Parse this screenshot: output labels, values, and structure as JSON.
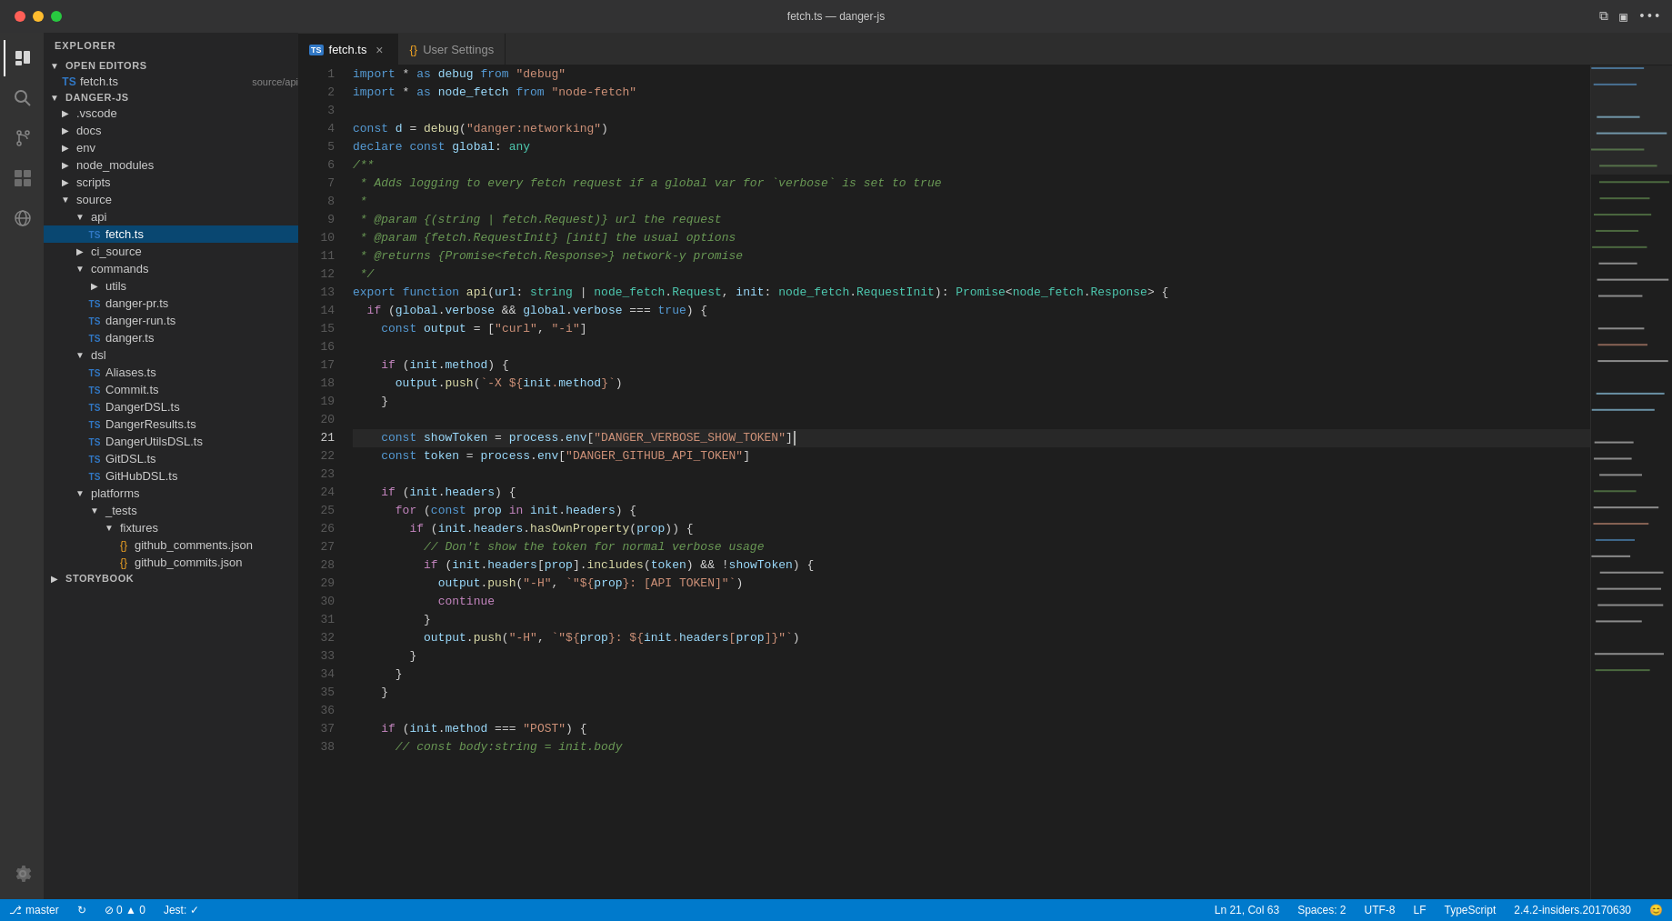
{
  "titlebar": {
    "title": "fetch.ts — danger-js",
    "actions": [
      "split-editor-icon",
      "toggle-panel-icon",
      "more-icon"
    ]
  },
  "activity_bar": {
    "icons": [
      {
        "name": "explorer-icon",
        "symbol": "☰",
        "active": true
      },
      {
        "name": "search-icon",
        "symbol": "🔍",
        "active": false
      },
      {
        "name": "source-control-icon",
        "symbol": "⑂",
        "active": false
      },
      {
        "name": "extensions-icon",
        "symbol": "⊞",
        "active": false
      },
      {
        "name": "remote-explorer-icon",
        "symbol": "⊡",
        "active": false
      }
    ],
    "bottom_icons": [
      {
        "name": "settings-icon",
        "symbol": "⚙",
        "active": false
      }
    ]
  },
  "sidebar": {
    "header": "EXPLORER",
    "sections": [
      {
        "name": "OPEN EDITORS",
        "items": [
          {
            "type": "file",
            "name": "fetch.ts",
            "path": "source/api",
            "active": false,
            "indent": 1,
            "ts": true
          }
        ]
      },
      {
        "name": "DANGER-JS",
        "items": [
          {
            "type": "folder",
            "name": ".vscode",
            "indent": 1,
            "open": false
          },
          {
            "type": "folder",
            "name": "docs",
            "indent": 1,
            "open": false
          },
          {
            "type": "folder",
            "name": "env",
            "indent": 1,
            "open": false
          },
          {
            "type": "folder",
            "name": "node_modules",
            "indent": 1,
            "open": false
          },
          {
            "type": "folder",
            "name": "scripts",
            "indent": 1,
            "open": false
          },
          {
            "type": "folder",
            "name": "source",
            "indent": 1,
            "open": true
          },
          {
            "type": "folder",
            "name": "api",
            "indent": 2,
            "open": true
          },
          {
            "type": "file",
            "name": "fetch.ts",
            "indent": 3,
            "ts": true,
            "active": true
          },
          {
            "type": "folder",
            "name": "ci_source",
            "indent": 2,
            "open": false
          },
          {
            "type": "folder",
            "name": "commands",
            "indent": 2,
            "open": true
          },
          {
            "type": "folder",
            "name": "utils",
            "indent": 3,
            "open": false
          },
          {
            "type": "file",
            "name": "danger-pr.ts",
            "indent": 3,
            "ts": true
          },
          {
            "type": "file",
            "name": "danger-run.ts",
            "indent": 3,
            "ts": true
          },
          {
            "type": "file",
            "name": "danger.ts",
            "indent": 3,
            "ts": true
          },
          {
            "type": "folder",
            "name": "dsl",
            "indent": 2,
            "open": true
          },
          {
            "type": "file",
            "name": "Aliases.ts",
            "indent": 3,
            "ts": true
          },
          {
            "type": "file",
            "name": "Commit.ts",
            "indent": 3,
            "ts": true
          },
          {
            "type": "file",
            "name": "DangerDSL.ts",
            "indent": 3,
            "ts": true
          },
          {
            "type": "file",
            "name": "DangerResults.ts",
            "indent": 3,
            "ts": true
          },
          {
            "type": "file",
            "name": "DangerUtilsDSL.ts",
            "indent": 3,
            "ts": true
          },
          {
            "type": "file",
            "name": "GitDSL.ts",
            "indent": 3,
            "ts": true
          },
          {
            "type": "file",
            "name": "GitHubDSL.ts",
            "indent": 3,
            "ts": true
          },
          {
            "type": "folder",
            "name": "platforms",
            "indent": 2,
            "open": true
          },
          {
            "type": "folder",
            "name": "_tests",
            "indent": 3,
            "open": true
          },
          {
            "type": "folder",
            "name": "fixtures",
            "indent": 4,
            "open": true
          },
          {
            "type": "file",
            "name": "github_comments.json",
            "indent": 5,
            "json": true
          },
          {
            "type": "file",
            "name": "github_commits.json",
            "indent": 5,
            "json": true
          }
        ]
      },
      {
        "name": "STORYBOOK",
        "items": []
      }
    ]
  },
  "tabs": [
    {
      "name": "fetch.ts",
      "active": true,
      "ts": true,
      "closeable": true
    },
    {
      "name": "User Settings",
      "active": false,
      "json": true,
      "closeable": false
    }
  ],
  "code": {
    "filename": "fetch.ts",
    "lines": [
      {
        "n": 1,
        "text": "import * as debug from \"debug\""
      },
      {
        "n": 2,
        "text": "import * as node_fetch from \"node-fetch\""
      },
      {
        "n": 3,
        "text": ""
      },
      {
        "n": 4,
        "text": "const d = debug(\"danger:networking\")"
      },
      {
        "n": 5,
        "text": "declare const global: any"
      },
      {
        "n": 6,
        "text": "/**"
      },
      {
        "n": 7,
        "text": " * Adds logging to every fetch request if a global var for `verbose` is set to true"
      },
      {
        "n": 8,
        "text": " *"
      },
      {
        "n": 9,
        "text": " * @param {(string | fetch.Request)} url the request"
      },
      {
        "n": 10,
        "text": " * @param {fetch.RequestInit} [init] the usual options"
      },
      {
        "n": 11,
        "text": " * @returns {Promise<fetch.Response>} network-y promise"
      },
      {
        "n": 12,
        "text": " */"
      },
      {
        "n": 13,
        "text": "export function api(url: string | node_fetch.Request, init: node_fetch.RequestInit): Promise<node_fetch.Response> {"
      },
      {
        "n": 14,
        "text": "  if (global.verbose && global.verbose === true) {"
      },
      {
        "n": 15,
        "text": "    const output = [\"curl\", \"-i\"]"
      },
      {
        "n": 16,
        "text": ""
      },
      {
        "n": 17,
        "text": "    if (init.method) {"
      },
      {
        "n": 18,
        "text": "      output.push(`-X ${init.method}`)"
      },
      {
        "n": 19,
        "text": "    }"
      },
      {
        "n": 20,
        "text": ""
      },
      {
        "n": 21,
        "text": "    const showToken = process.env[\"DANGER_VERBOSE_SHOW_TOKEN\"]",
        "cursor": true
      },
      {
        "n": 22,
        "text": "    const token = process.env[\"DANGER_GITHUB_API_TOKEN\"]"
      },
      {
        "n": 23,
        "text": ""
      },
      {
        "n": 24,
        "text": "    if (init.headers) {"
      },
      {
        "n": 25,
        "text": "      for (const prop in init.headers) {"
      },
      {
        "n": 26,
        "text": "        if (init.headers.hasOwnProperty(prop)) {"
      },
      {
        "n": 27,
        "text": "          // Don't show the token for normal verbose usage"
      },
      {
        "n": 28,
        "text": "          if (init.headers[prop].includes(token) && !showToken) {"
      },
      {
        "n": 29,
        "text": "            output.push(\"-H\", `\"${prop}: [API TOKEN]\"`)"
      },
      {
        "n": 30,
        "text": "            continue"
      },
      {
        "n": 31,
        "text": "          }"
      },
      {
        "n": 32,
        "text": "          output.push(\"-H\", `\"${prop}: ${init.headers[prop]}\"`)"
      },
      {
        "n": 33,
        "text": "        }"
      },
      {
        "n": 34,
        "text": "      }"
      },
      {
        "n": 35,
        "text": "    }"
      },
      {
        "n": 36,
        "text": ""
      },
      {
        "n": 37,
        "text": "    if (init.method === \"POST\") {"
      },
      {
        "n": 38,
        "text": "      // const body:string = init.body"
      }
    ]
  },
  "status_bar": {
    "left": [
      {
        "icon": "git-branch-icon",
        "text": "master",
        "symbol": "⎇"
      },
      {
        "icon": "sync-icon",
        "text": ""
      },
      {
        "text": "⊘ 0 ▲ 0"
      },
      {
        "text": "Jest: ✓"
      }
    ],
    "right": [
      {
        "text": "Ln 21, Col 63"
      },
      {
        "text": "Spaces: 2"
      },
      {
        "text": "UTF-8"
      },
      {
        "text": "LF"
      },
      {
        "text": "TypeScript"
      },
      {
        "text": "2.4.2-insiders.20170630"
      },
      {
        "icon": "smiley-icon",
        "text": "😊"
      }
    ]
  }
}
